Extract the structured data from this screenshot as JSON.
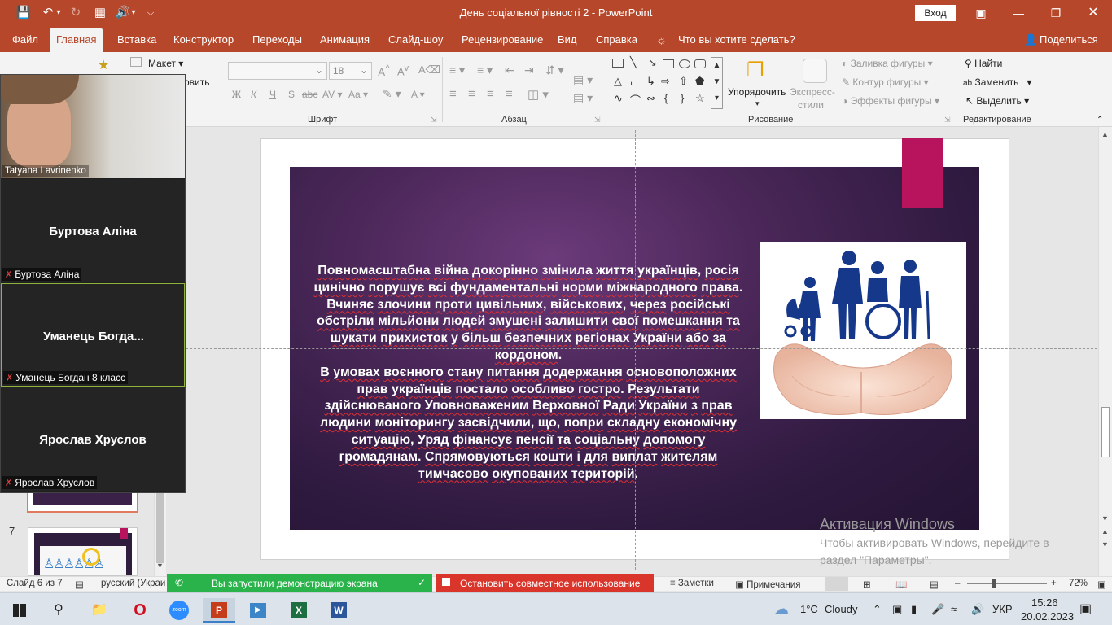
{
  "window": {
    "title": "День соціальної рівності 2  -  PowerPoint",
    "login_label": "Вход"
  },
  "menu": {
    "tabs": [
      "Файл",
      "Главная",
      "Вставка",
      "Конструктор",
      "Переходы",
      "Анимация",
      "Слайд-шоу",
      "Рецензирование",
      "Вид",
      "Справка"
    ],
    "search_prompt": "Что вы хотите сделать?",
    "share_label": "Поделиться"
  },
  "ribbon": {
    "layout_label": "Макет",
    "font_size": "18",
    "bold": "Ж",
    "italic": "К",
    "underline": "Ч",
    "strike": "S",
    "groups": {
      "font": "Шрифт",
      "paragraph": "Абзац",
      "drawing": "Рисование",
      "editing": "Редактирование"
    },
    "arrange_label": "Упорядочить",
    "express_styles_label_1": "Экспресс-",
    "express_styles_label_2": "стили",
    "shape_fill": "Заливка фигуры",
    "shape_outline": "Контур фигуры",
    "shape_effects": "Эффекты фигуры",
    "find": "Найти",
    "replace": "Заменить",
    "select": "Выделить"
  },
  "zoom": {
    "participants": [
      {
        "name": "Tatyana Lavrinenko",
        "video": true
      },
      {
        "display": "Буртова Аліна",
        "label": "Буртова Аліна",
        "video": false
      },
      {
        "display": "Уманець  Богда...",
        "label": "Уманець Богдан 8 класс",
        "video": false
      },
      {
        "display": "Ярослав Хруслов",
        "label": "Ярослав Хруслов",
        "video": false
      }
    ]
  },
  "slide_panel": {
    "thumb_number": "7"
  },
  "slide": {
    "paragraph_1": [
      "Повномасштабна",
      " ",
      "війна",
      " ",
      "докорінно",
      " ",
      "змінила",
      " ",
      "життя",
      " ",
      "українців",
      ", ",
      "росія",
      " ",
      "цинічно",
      " ",
      "порушує",
      " ",
      "всі",
      " ",
      "фундаментальні",
      " ",
      "норми",
      " ",
      "міжнародного",
      " ",
      "права",
      ". ",
      "Вчиняє",
      " ",
      "злочини",
      " ",
      "проти",
      " ",
      "цивільних",
      ", ",
      "військових",
      ", ",
      "через",
      " ",
      "російські",
      " ",
      "обстріли",
      " ",
      "мільйони",
      " ",
      "людей",
      " ",
      "змушені",
      " ",
      "залишити",
      " ",
      "свої",
      " ",
      "помешкання",
      " ",
      "та",
      " ",
      "шукати",
      " ",
      "прихисток",
      " ",
      "у",
      " ",
      "більш",
      " ",
      "безпечних",
      " ",
      "регіонах",
      " ",
      "України",
      " ",
      "або",
      " ",
      "за",
      " ",
      "кордоном",
      "."
    ],
    "paragraph_2": [
      "В",
      " ",
      "умовах",
      " ",
      "воєнного",
      " ",
      "стану",
      " ",
      "питання",
      " ",
      "додержання",
      " ",
      "основоположних",
      " ",
      "прав",
      " ",
      "українців",
      " ",
      "постало",
      " ",
      "особливо",
      " ",
      "гостро",
      ". ",
      "Результати",
      " ",
      "здійснюваного",
      " ",
      "Уповноваженим",
      " ",
      "Верховної",
      " ",
      "Ради",
      " ",
      "України",
      " ",
      "з",
      " ",
      "прав",
      " ",
      "людини",
      " ",
      "моніторингу",
      " ",
      "засвідчили",
      ", ",
      "що",
      ", ",
      "попри",
      " ",
      "складну",
      " ",
      "економічну",
      " ",
      "ситуацію",
      ", ",
      "Уряд",
      " ",
      "фінансує",
      " ",
      "пенсії",
      " ",
      "та",
      " ",
      "соціальну",
      " ",
      "допомогу",
      " ",
      "громадянам",
      ". ",
      "Спрямовуються",
      " ",
      "кошти",
      " ",
      "і",
      " ",
      "для",
      " ",
      "виплат",
      " ",
      "жителям",
      " ",
      "тимчасово",
      " ",
      "окупованих",
      " ",
      "територій",
      "."
    ]
  },
  "activation": {
    "title": "Активация Windows",
    "line": "Чтобы активировать Windows, перейдите в раздел \"Параметры\"."
  },
  "status": {
    "slide_counter": "Слайд 6 из 7",
    "language": "русский (Украи",
    "sharing_msg": "Вы запустили демонстрацию экрана",
    "stop_sharing": "Остановить совместное использование",
    "notes": "Заметки",
    "comments": "Примечания",
    "zoom_pct": "72%"
  },
  "taskbar": {
    "weather_temp": "1°C",
    "weather_text": "Cloudy",
    "lang": "УКР",
    "time": "15:26",
    "date": "20.02.2023"
  },
  "colors": {
    "accent": "#b7472a",
    "slide_pink": "#b8145e",
    "share_green": "#2bb34b",
    "stop_red": "#d9352b"
  }
}
